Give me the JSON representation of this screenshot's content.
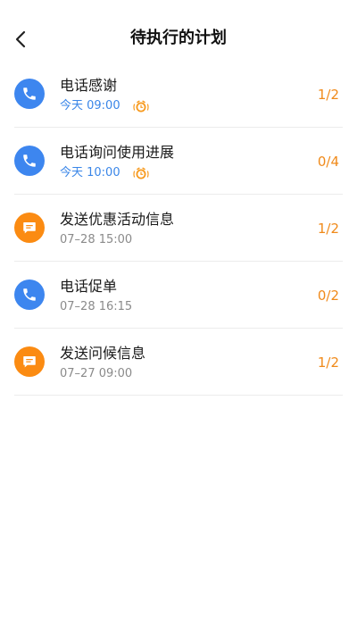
{
  "header": {
    "title": "待执行的计划"
  },
  "colors": {
    "phone": "#3d86ef",
    "message": "#fb8b12",
    "today_text": "#3a86e8",
    "count_text": "#f08a1a"
  },
  "plans": [
    {
      "title": "电话感谢",
      "time": "今天 09:00",
      "count": "1/2",
      "icon": "phone-icon",
      "alarm": true
    },
    {
      "title": "电话询问使用进展",
      "time": "今天 10:00",
      "count": "0/4",
      "icon": "phone-icon",
      "alarm": true
    },
    {
      "title": "发送优惠活动信息",
      "time": "07–28  15:00",
      "count": "1/2",
      "icon": "message-icon",
      "alarm": false
    },
    {
      "title": "电话促单",
      "time": "07–28 16:15",
      "count": "0/2",
      "icon": "phone-icon",
      "alarm": false
    },
    {
      "title": "发送问候信息",
      "time": "07–27 09:00",
      "count": "1/2",
      "icon": "message-icon",
      "alarm": false
    }
  ]
}
